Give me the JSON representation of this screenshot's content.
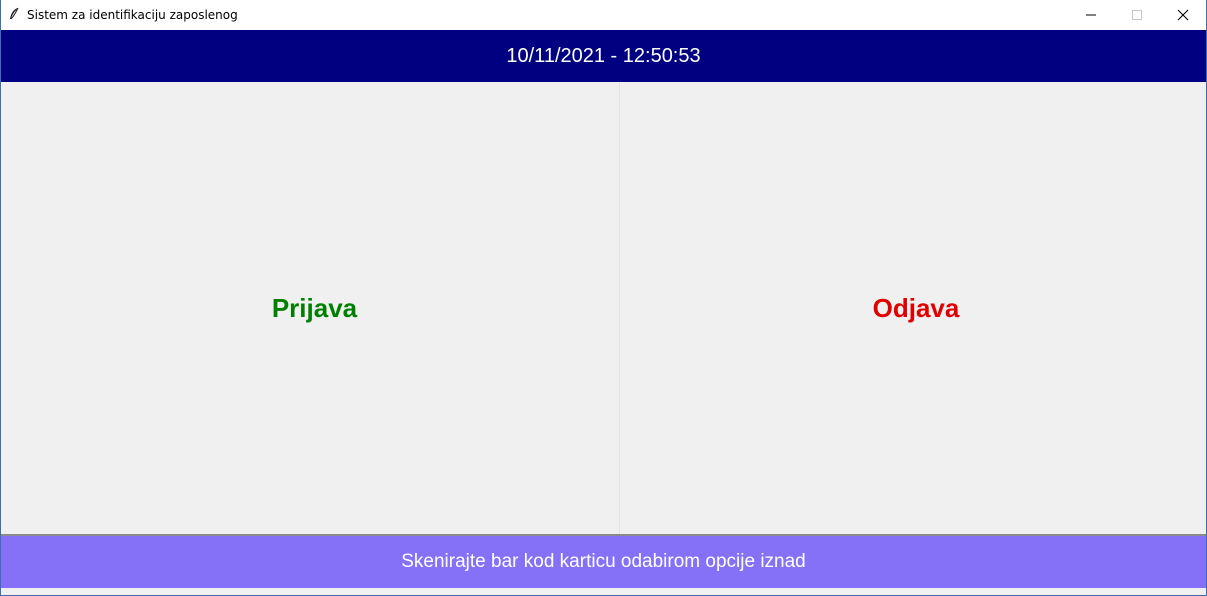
{
  "window": {
    "title": "Sistem za identifikaciju zaposlenog",
    "app_icon": "feather-icon",
    "controls": {
      "minimize_icon": "minimize-icon",
      "maximize_icon": "maximize-icon",
      "close_icon": "close-icon"
    }
  },
  "header": {
    "datetime": "10/11/2021 - 12:50:53",
    "background": "#000080",
    "text_color": "#ffffff"
  },
  "actions": {
    "login_label": "Prijava",
    "login_color": "#008000",
    "logout_label": "Odjava",
    "logout_color": "#e00000"
  },
  "status": {
    "message": "Skenirajte bar kod karticu odabirom opcije iznad",
    "background": "#8570f8"
  }
}
